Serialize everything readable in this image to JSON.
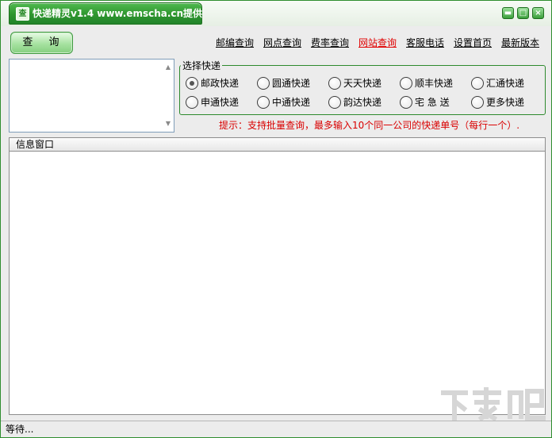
{
  "window": {
    "title": "快递精灵v1.4 www.emscha.cn提供",
    "app_icon_glyph": "查",
    "controls": {
      "minimize": "▬",
      "maximize": "□",
      "close": "×"
    }
  },
  "toolbar": {
    "query_label": "查 询",
    "links": [
      {
        "label": "邮编查询",
        "active": false
      },
      {
        "label": "网点查询",
        "active": false
      },
      {
        "label": "费率查询",
        "active": false
      },
      {
        "label": "网站查询",
        "active": true
      },
      {
        "label": "客服电话",
        "active": false
      },
      {
        "label": "设置首页",
        "active": false
      },
      {
        "label": "最新版本",
        "active": false
      }
    ]
  },
  "tracking_input": {
    "value": ""
  },
  "courier_group": {
    "legend": "选择快递",
    "options": [
      "邮政快递",
      "圆通快递",
      "天天快递",
      "顺丰快递",
      "汇通快递",
      "申通快递",
      "中通快递",
      "韵达快递",
      "宅 急 送",
      "更多快递"
    ],
    "selected": "邮政快递"
  },
  "tip": "提示：支持批量查询，最多输入10个同一公司的快递单号（每行一个）.",
  "info_window": {
    "title": "信息窗口",
    "content": ""
  },
  "status": {
    "text": "等待..."
  },
  "watermark": {
    "text": "下载吧",
    "url": "www.xiazaiba.com"
  },
  "colors": {
    "accent": "#2e962e",
    "link_active": "#e00000",
    "tip": "#d90000"
  }
}
